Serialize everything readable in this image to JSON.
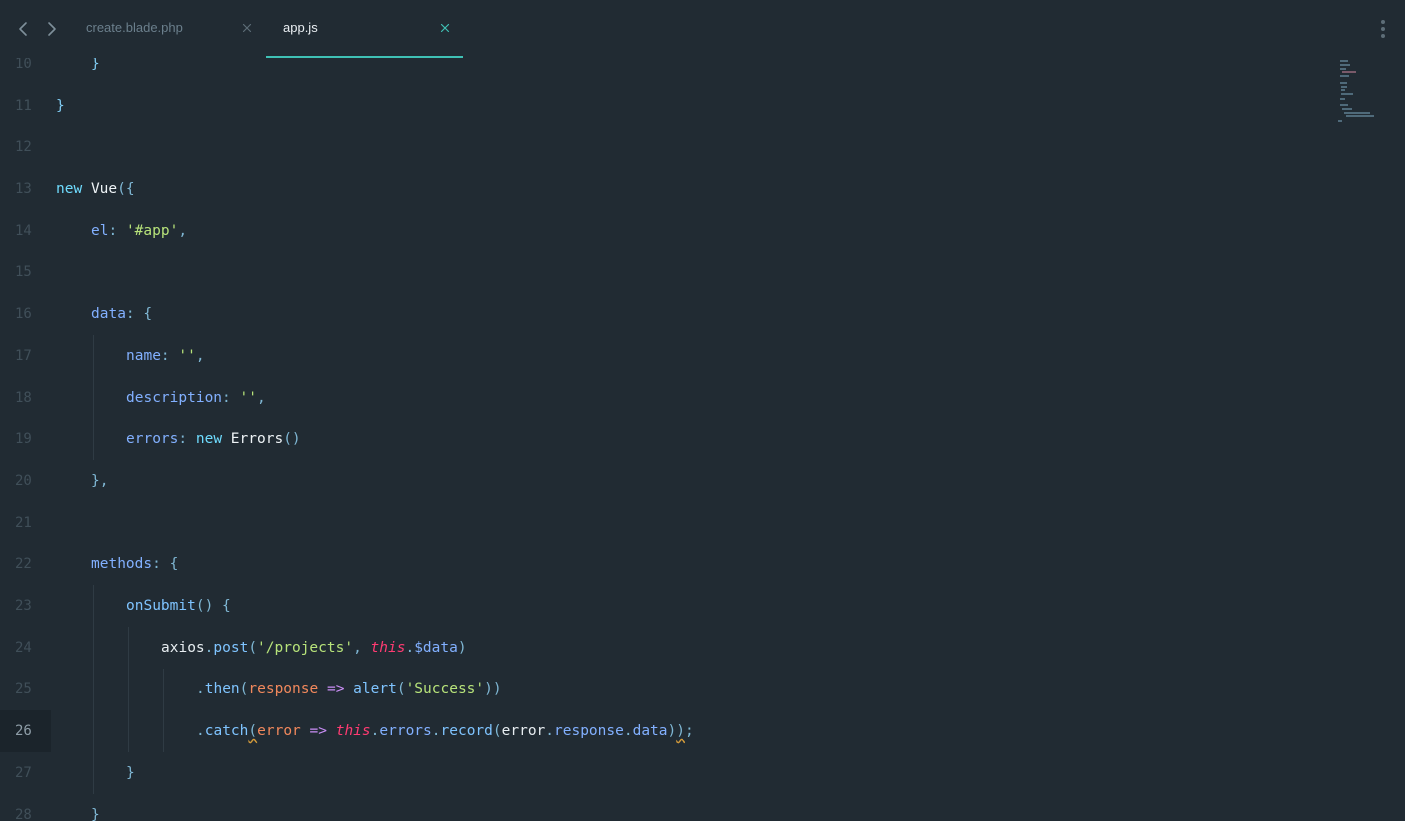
{
  "tabs": [
    {
      "label": "create.blade.php",
      "active": false
    },
    {
      "label": "app.js",
      "active": true
    }
  ],
  "colors": {
    "background": "#212b33",
    "active_tab_underline": "#3fc1b5",
    "keyword": "#6fdcff",
    "string": "#b7e37a",
    "this_keyword": "#ff3b72",
    "parameter": "#f1885c"
  },
  "icons": {
    "back": "chevron-left-icon",
    "forward": "chevron-right-icon",
    "close": "close-icon",
    "menu": "more-vertical-icon"
  },
  "editor": {
    "current_line": 26,
    "lines": [
      {
        "num": "10",
        "tokens": [
          {
            "t": "}",
            "c": "t-brace"
          }
        ]
      },
      {
        "num": "11",
        "tokens": [
          {
            "t": "}",
            "c": "t-brace"
          }
        ]
      },
      {
        "num": "12",
        "tokens": []
      },
      {
        "num": "13",
        "tokens": [
          {
            "t": "new",
            "c": "t-kw"
          },
          {
            "t": " "
          },
          {
            "t": "Vue",
            "c": "t-ident"
          },
          {
            "t": "({",
            "c": "t-punc"
          }
        ]
      },
      {
        "num": "14",
        "tokens": [
          {
            "t": "el",
            "c": "t-prop"
          },
          {
            "t": ": ",
            "c": "t-punc"
          },
          {
            "t": "'#app'",
            "c": "t-str"
          },
          {
            "t": ",",
            "c": "t-punc"
          }
        ]
      },
      {
        "num": "15",
        "tokens": []
      },
      {
        "num": "16",
        "tokens": [
          {
            "t": "data",
            "c": "t-prop"
          },
          {
            "t": ": {",
            "c": "t-punc"
          }
        ]
      },
      {
        "num": "17",
        "tokens": [
          {
            "t": "name",
            "c": "t-prop"
          },
          {
            "t": ": ",
            "c": "t-punc"
          },
          {
            "t": "''",
            "c": "t-str"
          },
          {
            "t": ",",
            "c": "t-punc"
          }
        ]
      },
      {
        "num": "18",
        "tokens": [
          {
            "t": "description",
            "c": "t-prop"
          },
          {
            "t": ": ",
            "c": "t-punc"
          },
          {
            "t": "''",
            "c": "t-str"
          },
          {
            "t": ",",
            "c": "t-punc"
          }
        ]
      },
      {
        "num": "19",
        "tokens": [
          {
            "t": "errors",
            "c": "t-prop"
          },
          {
            "t": ": ",
            "c": "t-punc"
          },
          {
            "t": "new",
            "c": "t-kw"
          },
          {
            "t": " "
          },
          {
            "t": "Errors",
            "c": "t-ident"
          },
          {
            "t": "()",
            "c": "t-punc"
          }
        ]
      },
      {
        "num": "20",
        "tokens": [
          {
            "t": "},",
            "c": "t-punc"
          }
        ]
      },
      {
        "num": "21",
        "tokens": []
      },
      {
        "num": "22",
        "tokens": [
          {
            "t": "methods",
            "c": "t-prop"
          },
          {
            "t": ": {",
            "c": "t-punc"
          }
        ]
      },
      {
        "num": "23",
        "tokens": [
          {
            "t": "onSubmit",
            "c": "t-func"
          },
          {
            "t": "() {",
            "c": "t-punc"
          }
        ]
      },
      {
        "num": "24",
        "tokens": [
          {
            "t": "axios",
            "c": "t-plain"
          },
          {
            "t": ".",
            "c": "t-punc"
          },
          {
            "t": "post",
            "c": "t-func"
          },
          {
            "t": "(",
            "c": "t-punc"
          },
          {
            "t": "'/projects'",
            "c": "t-str"
          },
          {
            "t": ", ",
            "c": "t-punc"
          },
          {
            "t": "this",
            "c": "t-this"
          },
          {
            "t": ".",
            "c": "t-punc"
          },
          {
            "t": "$data",
            "c": "t-prop"
          },
          {
            "t": ")",
            "c": "t-punc"
          }
        ]
      },
      {
        "num": "25",
        "tokens": [
          {
            "t": ".",
            "c": "t-punc"
          },
          {
            "t": "then",
            "c": "t-func"
          },
          {
            "t": "(",
            "c": "t-punc"
          },
          {
            "t": "response",
            "c": "t-param"
          },
          {
            "t": " "
          },
          {
            "t": "=>",
            "c": "t-arrow"
          },
          {
            "t": " "
          },
          {
            "t": "alert",
            "c": "t-func"
          },
          {
            "t": "(",
            "c": "t-punc"
          },
          {
            "t": "'Success'",
            "c": "t-str"
          },
          {
            "t": "))",
            "c": "t-punc"
          }
        ]
      },
      {
        "num": "26",
        "tokens": [
          {
            "t": ".",
            "c": "t-punc"
          },
          {
            "t": "catch",
            "c": "t-func"
          },
          {
            "t": "(",
            "c": "t-punc squiggle"
          },
          {
            "t": "error",
            "c": "t-param"
          },
          {
            "t": " "
          },
          {
            "t": "=>",
            "c": "t-arrow"
          },
          {
            "t": " "
          },
          {
            "t": "this",
            "c": "t-this"
          },
          {
            "t": ".",
            "c": "t-punc"
          },
          {
            "t": "errors",
            "c": "t-prop"
          },
          {
            "t": ".",
            "c": "t-punc"
          },
          {
            "t": "record",
            "c": "t-func"
          },
          {
            "t": "(",
            "c": "t-punc"
          },
          {
            "t": "error",
            "c": "t-plain"
          },
          {
            "t": ".",
            "c": "t-punc"
          },
          {
            "t": "response",
            "c": "t-prop"
          },
          {
            "t": ".",
            "c": "t-punc"
          },
          {
            "t": "data",
            "c": "t-prop"
          },
          {
            "t": ")",
            "c": "t-punc"
          },
          {
            "t": ")",
            "c": "t-punc squiggle"
          },
          {
            "t": ";",
            "c": "t-punc"
          }
        ]
      },
      {
        "num": "27",
        "tokens": [
          {
            "t": "}",
            "c": "t-punc"
          }
        ]
      },
      {
        "num": "28",
        "tokens": [
          {
            "t": "}",
            "c": "t-punc"
          }
        ]
      }
    ]
  }
}
